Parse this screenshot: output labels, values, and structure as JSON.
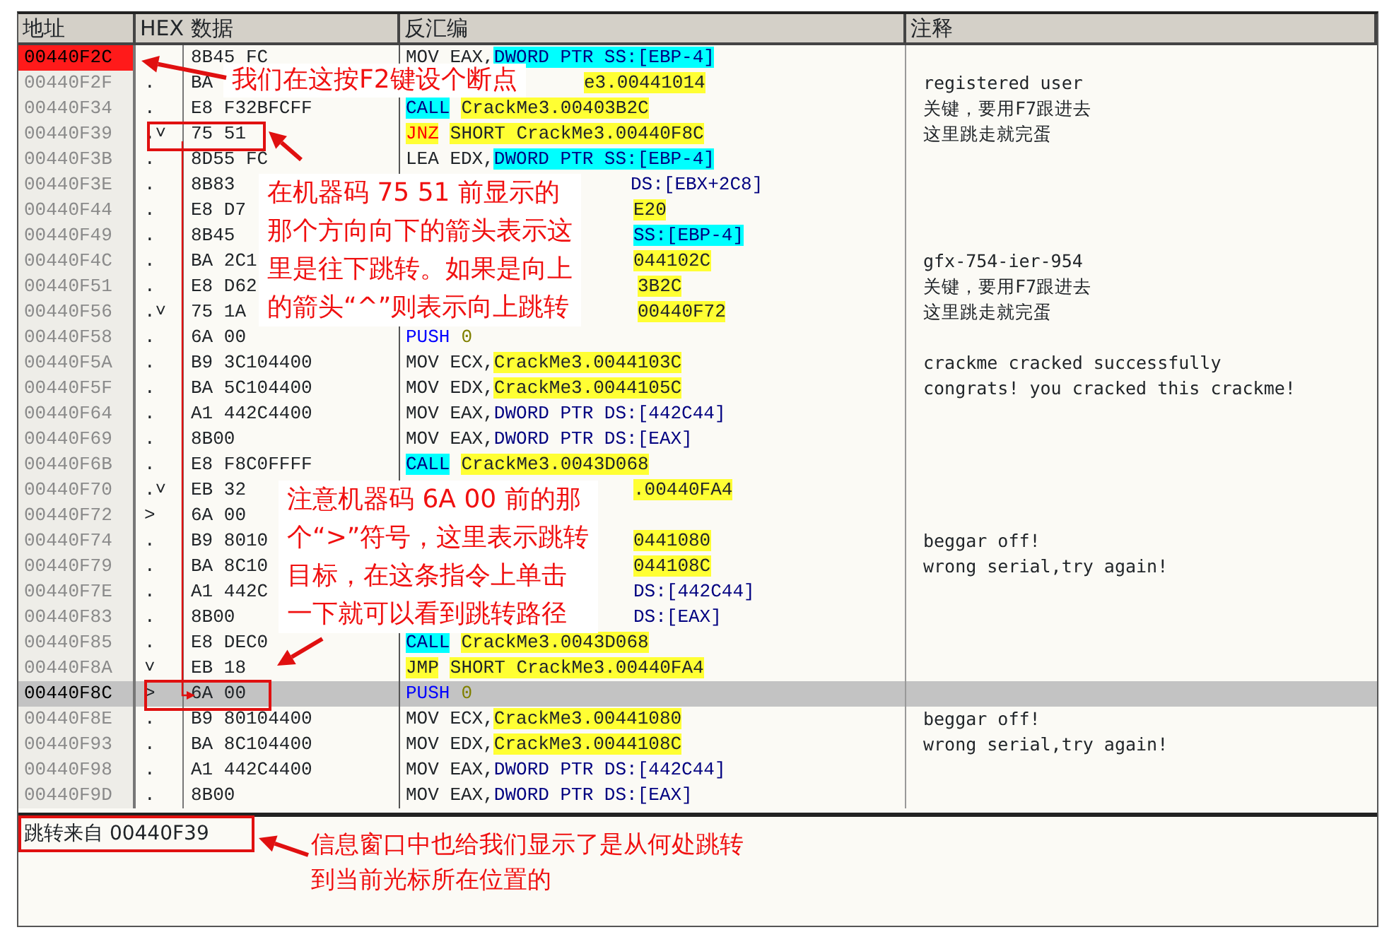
{
  "columns": [
    "地址",
    "HEX 数据",
    "反汇编",
    "注释"
  ],
  "rows": [
    {
      "address": "00440F2C",
      "marker": "",
      "hex": "8B45 FC",
      "disasm": [
        {
          "kind": "text",
          "text": "MOV EAX,"
        },
        {
          "kind": "ssmem",
          "text": "DWORD PTR SS:[EBP-4]"
        }
      ],
      "comment": "",
      "breakpoint": true,
      "selected": false
    },
    {
      "address": "00440F2F",
      "marker": ".",
      "hex": "BA",
      "disasm": [
        {
          "kind": "sym",
          "text": "e3.00441014"
        }
      ],
      "comment": "registered user",
      "breakpoint": false,
      "selected": false
    },
    {
      "address": "00440F34",
      "marker": ".",
      "hex": "E8 F32BFCFF",
      "disasm": [
        {
          "kind": "call",
          "text": "CALL"
        },
        {
          "kind": "sym",
          "text": "CrackMe3.00403B2C"
        }
      ],
      "comment": "关键，要用F7跟进去",
      "breakpoint": false,
      "selected": false
    },
    {
      "address": "00440F39",
      "marker": ".˅",
      "hex": "75 51",
      "disasm": [
        {
          "kind": "jcc",
          "text": "JNZ"
        },
        {
          "kind": "sym",
          "text": "SHORT CrackMe3.00440F8C"
        }
      ],
      "comment": "这里跳走就完蛋",
      "breakpoint": false,
      "selected": false
    },
    {
      "address": "00440F3B",
      "marker": ".",
      "hex": "8D55 FC",
      "disasm": [
        {
          "kind": "text",
          "text": "LEA EDX,"
        },
        {
          "kind": "ssmem",
          "text": "DWORD PTR SS:[EBP-4]"
        }
      ],
      "comment": "",
      "breakpoint": false,
      "selected": false
    },
    {
      "address": "00440F3E",
      "marker": ".",
      "hex": "8B83",
      "disasm": [
        {
          "kind": "dsmem",
          "text": "DS:[EBX+2C8]"
        }
      ],
      "comment": "",
      "breakpoint": false,
      "selected": false
    },
    {
      "address": "00440F44",
      "marker": ".",
      "hex": "E8 D7",
      "disasm": [
        {
          "kind": "sym",
          "text": "E20"
        }
      ],
      "comment": "",
      "breakpoint": false,
      "selected": false
    },
    {
      "address": "00440F49",
      "marker": ".",
      "hex": "8B45",
      "disasm": [
        {
          "kind": "ssmem",
          "text": "SS:[EBP-4]"
        }
      ],
      "comment": "",
      "breakpoint": false,
      "selected": false
    },
    {
      "address": "00440F4C",
      "marker": ".",
      "hex": "BA 2C1",
      "disasm": [
        {
          "kind": "sym",
          "text": "044102C"
        }
      ],
      "comment": "gfx-754-ier-954",
      "breakpoint": false,
      "selected": false
    },
    {
      "address": "00440F51",
      "marker": ".",
      "hex": "E8 D62",
      "disasm": [
        {
          "kind": "sym",
          "text": "3B2C"
        }
      ],
      "comment": "关键，要用F7跟进去",
      "breakpoint": false,
      "selected": false
    },
    {
      "address": "00440F56",
      "marker": ".˅",
      "hex": "75 1A",
      "disasm": [
        {
          "kind": "sym",
          "text": "00440F72"
        }
      ],
      "comment": "这里跳走就完蛋",
      "breakpoint": false,
      "selected": false
    },
    {
      "address": "00440F58",
      "marker": ".",
      "hex": "6A 00",
      "disasm": [
        {
          "kind": "push",
          "text": "PUSH"
        },
        {
          "kind": "imm",
          "text": "0"
        }
      ],
      "comment": "",
      "breakpoint": false,
      "selected": false
    },
    {
      "address": "00440F5A",
      "marker": ".",
      "hex": "B9 3C104400",
      "disasm": [
        {
          "kind": "text",
          "text": "MOV ECX,"
        },
        {
          "kind": "sym",
          "text": "CrackMe3.0044103C"
        }
      ],
      "comment": "crackme cracked successfully",
      "breakpoint": false,
      "selected": false
    },
    {
      "address": "00440F5F",
      "marker": ".",
      "hex": "BA 5C104400",
      "disasm": [
        {
          "kind": "text",
          "text": "MOV EDX,"
        },
        {
          "kind": "sym",
          "text": "CrackMe3.0044105C"
        }
      ],
      "comment": "congrats! you cracked this crackme!",
      "breakpoint": false,
      "selected": false
    },
    {
      "address": "00440F64",
      "marker": ".",
      "hex": "A1 442C4400",
      "disasm": [
        {
          "kind": "text",
          "text": "MOV EAX,"
        },
        {
          "kind": "dsmem",
          "text": "DWORD PTR DS:[442C44]"
        }
      ],
      "comment": "",
      "breakpoint": false,
      "selected": false
    },
    {
      "address": "00440F69",
      "marker": ".",
      "hex": "8B00",
      "disasm": [
        {
          "kind": "text",
          "text": "MOV EAX,"
        },
        {
          "kind": "dsmem",
          "text": "DWORD PTR DS:[EAX]"
        }
      ],
      "comment": "",
      "breakpoint": false,
      "selected": false
    },
    {
      "address": "00440F6B",
      "marker": ".",
      "hex": "E8 F8C0FFFF",
      "disasm": [
        {
          "kind": "call",
          "text": "CALL"
        },
        {
          "kind": "sym",
          "text": "CrackMe3.0043D068"
        }
      ],
      "comment": "",
      "breakpoint": false,
      "selected": false
    },
    {
      "address": "00440F70",
      "marker": ".˅",
      "hex": "EB 32",
      "disasm": [
        {
          "kind": "sym",
          "text": ".00440FA4"
        }
      ],
      "comment": "",
      "breakpoint": false,
      "selected": false
    },
    {
      "address": "00440F72",
      "marker": ">",
      "hex": "6A 00",
      "disasm": [],
      "comment": "",
      "breakpoint": false,
      "selected": false
    },
    {
      "address": "00440F74",
      "marker": ".",
      "hex": "B9 8010",
      "disasm": [
        {
          "kind": "sym",
          "text": "0441080"
        }
      ],
      "comment": "beggar off!",
      "breakpoint": false,
      "selected": false
    },
    {
      "address": "00440F79",
      "marker": ".",
      "hex": "BA 8C10",
      "disasm": [
        {
          "kind": "sym",
          "text": "044108C"
        }
      ],
      "comment": "wrong serial,try again!",
      "breakpoint": false,
      "selected": false
    },
    {
      "address": "00440F7E",
      "marker": ".",
      "hex": "A1 442C",
      "disasm": [
        {
          "kind": "dsmem",
          "text": "DS:[442C44]"
        }
      ],
      "comment": "",
      "breakpoint": false,
      "selected": false
    },
    {
      "address": "00440F83",
      "marker": ".",
      "hex": "8B00",
      "disasm": [
        {
          "kind": "dsmem",
          "text": "DS:[EAX]"
        }
      ],
      "comment": "",
      "breakpoint": false,
      "selected": false
    },
    {
      "address": "00440F85",
      "marker": ".",
      "hex": "E8 DEC0",
      "disasm": [
        {
          "kind": "call",
          "text": "CALL"
        },
        {
          "kind": "sym",
          "text": "CrackMe3.0043D068"
        }
      ],
      "comment": "",
      "breakpoint": false,
      "selected": false
    },
    {
      "address": "00440F8A",
      "marker": "˅",
      "hex": "EB 18",
      "disasm": [
        {
          "kind": "jmp",
          "text": "JMP"
        },
        {
          "kind": "sym",
          "text": "SHORT CrackMe3.00440FA4"
        }
      ],
      "comment": "",
      "breakpoint": false,
      "selected": false
    },
    {
      "address": "00440F8C",
      "marker": ">",
      "hex": "6A 00",
      "disasm": [
        {
          "kind": "push",
          "text": "PUSH"
        },
        {
          "kind": "imm",
          "text": "0"
        }
      ],
      "comment": "",
      "breakpoint": false,
      "selected": true
    },
    {
      "address": "00440F8E",
      "marker": ".",
      "hex": "B9 80104400",
      "disasm": [
        {
          "kind": "text",
          "text": "MOV ECX,"
        },
        {
          "kind": "sym",
          "text": "CrackMe3.00441080"
        }
      ],
      "comment": "beggar off!",
      "breakpoint": false,
      "selected": false
    },
    {
      "address": "00440F93",
      "marker": ".",
      "hex": "BA 8C104400",
      "disasm": [
        {
          "kind": "text",
          "text": "MOV EDX,"
        },
        {
          "kind": "sym",
          "text": "CrackMe3.0044108C"
        }
      ],
      "comment": "wrong serial,try again!",
      "breakpoint": false,
      "selected": false
    },
    {
      "address": "00440F98",
      "marker": ".",
      "hex": "A1 442C4400",
      "disasm": [
        {
          "kind": "text",
          "text": "MOV EAX,"
        },
        {
          "kind": "dsmem",
          "text": "DWORD PTR DS:[442C44]"
        }
      ],
      "comment": "",
      "breakpoint": false,
      "selected": false
    },
    {
      "address": "00440F9D",
      "marker": ".",
      "hex": "8B00",
      "disasm": [
        {
          "kind": "text",
          "text": "MOV EAX,"
        },
        {
          "kind": "dsmem",
          "text": "DWORD PTR DS:[EAX]"
        }
      ],
      "comment": "",
      "breakpoint": false,
      "selected": false
    }
  ],
  "info_pane": {
    "text": "跳转来自 00440F39"
  },
  "callouts": [
    {
      "lines": [
        "我们在这按F2键设个断点"
      ]
    },
    {
      "lines": [
        "在机器码 75 51 前显示的",
        "那个方向向下的箭头表示这",
        "里是往下跳转。如果是向上",
        "的箭头“^”则表示向上跳转"
      ]
    },
    {
      "lines": [
        "注意机器码 6A 00 前的那",
        "个“>”符号，这里表示跳转",
        "目标，在这条指令上单击",
        "一下就可以看到跳转路径"
      ]
    },
    {
      "lines": [
        "信息窗口中也给我们显示了是从何处跳转",
        "到当前光标所在位置的"
      ]
    }
  ]
}
